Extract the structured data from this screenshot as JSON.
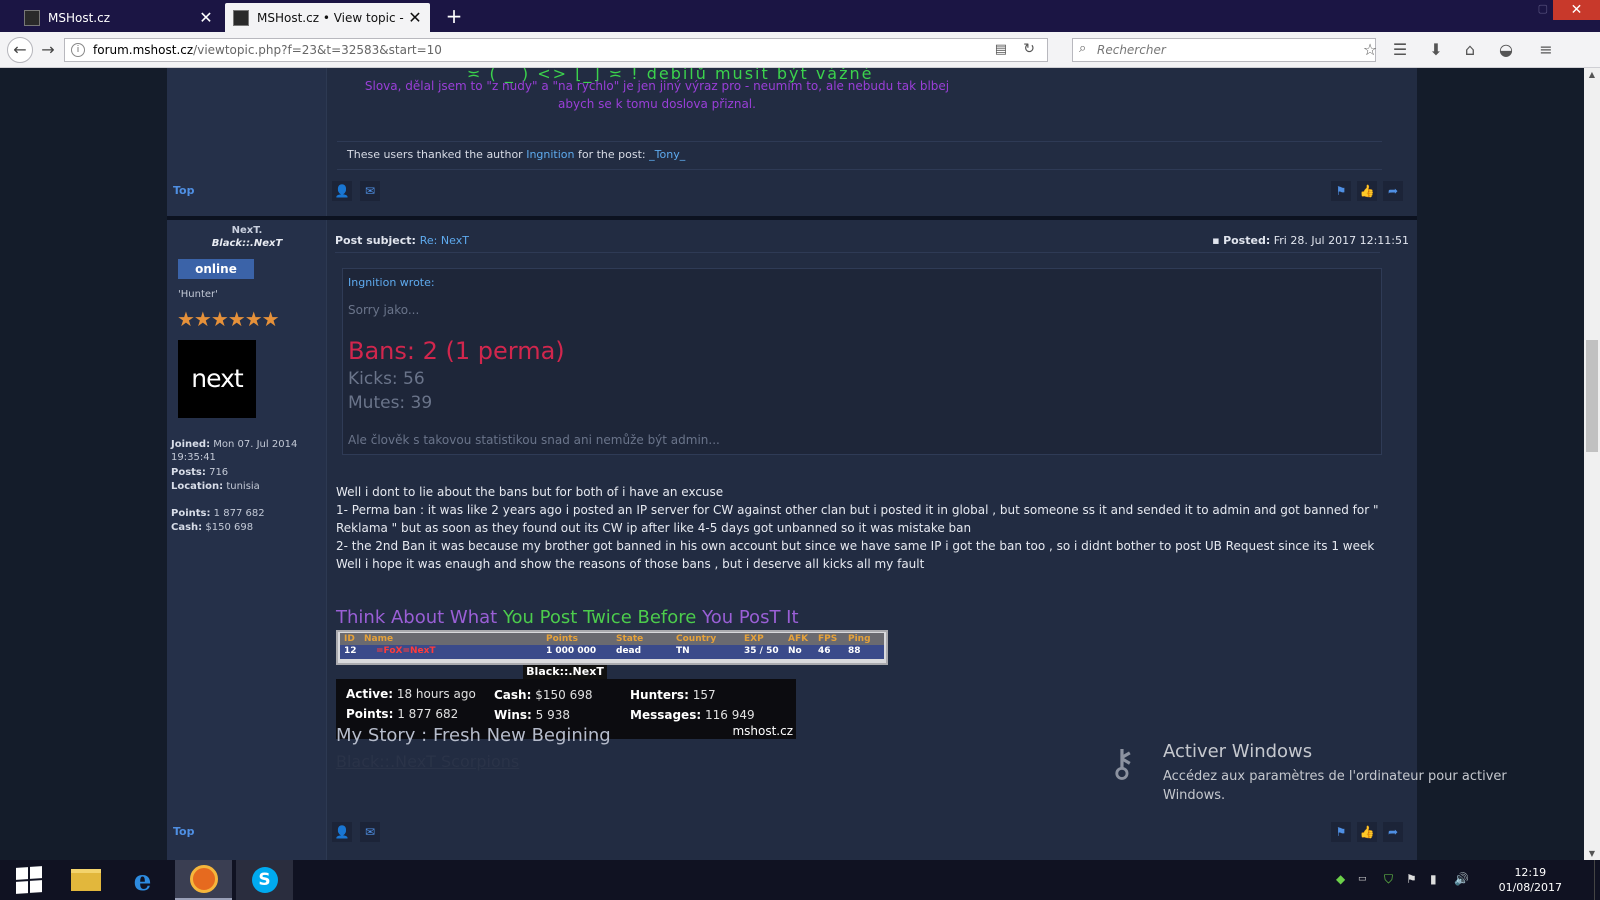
{
  "tabs": [
    {
      "title": "MSHost.cz"
    },
    {
      "title": "MSHost.cz • View topic - NexT"
    }
  ],
  "nav": {
    "url_domain": "forum.mshost.cz",
    "url_path": "/viewtopic.php?f=23&t=32583&start=10",
    "search_placeholder": "Rechercher"
  },
  "post1": {
    "sig_anim": "≍ ( _ ) <> ⌊_⌋ ≍ ! debilů musit být vážné",
    "sig_line1": "Slova, dělal jsem to \"z nudy\" a \"na rychlo\" je jen jiný výraz pro - neumím to, ale nebudu tak blbej",
    "sig_line2": "abych se k tomu doslova přiznal.",
    "thanks_prefix": "These users thanked the author",
    "thanks_author": "Ingnition",
    "thanks_mid": "for the post:",
    "thanks_user": "_Tony_",
    "top_label": "Top"
  },
  "post2": {
    "username": "NexT.",
    "fullname": "Black::.NexT",
    "status": "online",
    "rank": "'Hunter'",
    "stars": "★★★★★★",
    "avatar_text": "next",
    "joined_label": "Joined:",
    "joined_value": "Mon 07. Jul 2014 19:35:41",
    "posts_label": "Posts:",
    "posts_value": "716",
    "location_label": "Location:",
    "location_value": "tunisia",
    "points_label": "Points:",
    "points_value": "1 877 682",
    "cash_label": "Cash:",
    "cash_value": "$150 698",
    "subject_label": "Post subject:",
    "subject_value": "Re: NexT",
    "posted_label": "Posted:",
    "posted_value": "Fri 28. Jul 2017 12:11:51",
    "quote": {
      "author": "Ingnition wrote:",
      "line1": "Sorry jako...",
      "bans": "Bans: 2 (1 perma)",
      "kicks": "Kicks: 56",
      "mutes": "Mutes: 39",
      "line2": "Ale člověk s takovou statistikou snad ani nemůže být admin..."
    },
    "body": [
      "Well i dont to lie about the bans but for both of i have an excuse",
      "1- Perma ban : it was like 2 years ago i posted an IP server for CW against other clan but i posted it in global , but someone ss it and sended it to admin and got banned for \"",
      "Reklama \" but as soon as they found out its CW ip after like 4-5 days got unbanned so it was mistake ban",
      "2- the 2nd Ban it was because my brother got banned in his own account but since we have same IP i got the ban too , so i didnt bother to post UB Request since its 1 week",
      "Well i hope it was enaugh and show the reasons of those bans , but i deserve all kicks all my fault"
    ],
    "sig": {
      "think1": "Think About What",
      "think2": "You Post Twice Before",
      "think3": "You PosT It",
      "table_headers": [
        "ID",
        "Name",
        "Points",
        "State",
        "Country",
        "EXP",
        "AFK",
        "FPS",
        "Ping"
      ],
      "table_row": [
        "12",
        "=FoX=NexT",
        "1 000 000",
        "dead",
        "TN",
        "35 / 50",
        "No",
        "46",
        "88"
      ],
      "card_title": "Black::.NexT",
      "active_label": "Active:",
      "active_value": "18 hours ago",
      "cash_label": "Cash:",
      "cash_value": "$150 698",
      "hunters_label": "Hunters:",
      "hunters_value": "157",
      "points_label": "Points:",
      "points_value": "1 877 682",
      "wins_label": "Wins:",
      "wins_value": "5 938",
      "messages_label": "Messages:",
      "messages_value": "116 949",
      "brand": "mshost.cz",
      "story": "My Story : Fresh New Begining",
      "story2": "Black::.NexT Scorpions"
    },
    "top_label": "Top"
  },
  "activate": {
    "title": "Activer Windows",
    "text": "Accédez aux paramètres de l'ordinateur pour activer Windows."
  },
  "clock": {
    "time": "12:19",
    "date": "01/08/2017"
  }
}
